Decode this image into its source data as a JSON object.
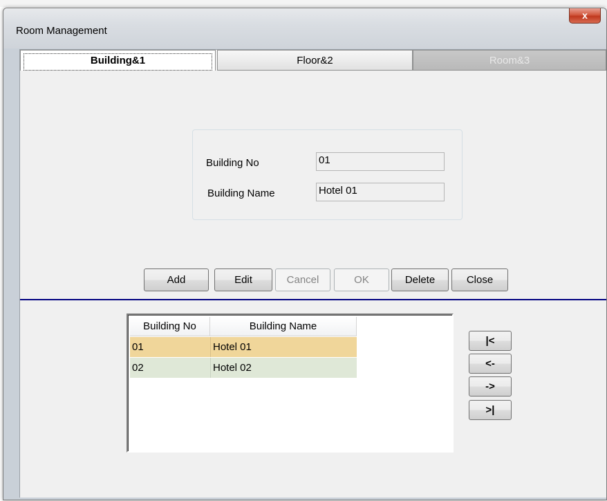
{
  "window": {
    "title": "Room Management",
    "close_glyph": "x"
  },
  "tabs": [
    {
      "label": "Building&1",
      "state": "active"
    },
    {
      "label": "Floor&2",
      "state": "normal"
    },
    {
      "label": "Room&3",
      "state": "disabled"
    }
  ],
  "form": {
    "building_no_label": "Building No",
    "building_no_value": "01",
    "building_name_label": "Building Name",
    "building_name_value": "Hotel 01"
  },
  "actions": {
    "add": "Add",
    "edit": "Edit",
    "cancel": "Cancel",
    "ok": "OK",
    "delete": "Delete",
    "close": "Close"
  },
  "grid": {
    "columns": [
      "Building No",
      "Building Name"
    ],
    "rows": [
      [
        "01",
        "Hotel 01"
      ],
      [
        "02",
        "Hotel 02"
      ]
    ]
  },
  "navigation": {
    "first": "|<",
    "prev": "<-",
    "next": "->",
    "last": ">|"
  },
  "colors": {
    "selected_row": "#f0d69a",
    "alternate_row": "#dfe8d7",
    "separator": "#000080"
  }
}
